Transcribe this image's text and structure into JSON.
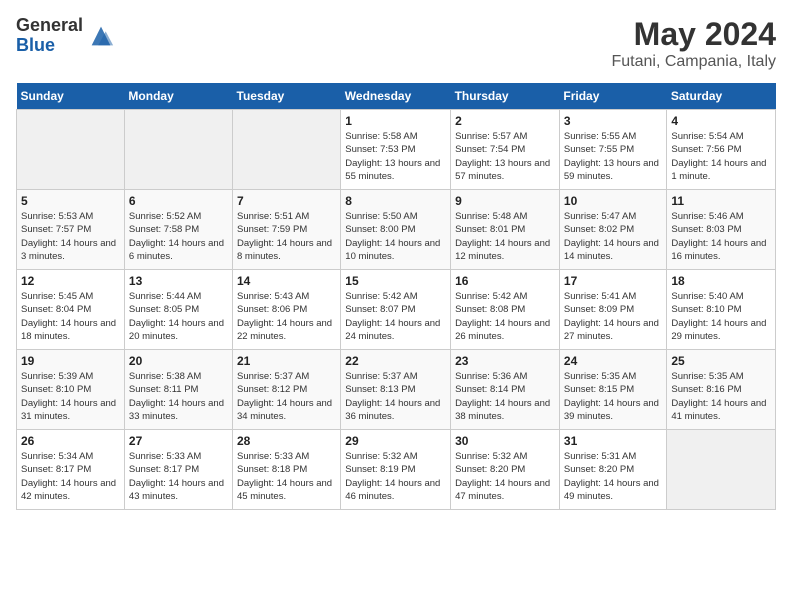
{
  "logo": {
    "general": "General",
    "blue": "Blue"
  },
  "title": "May 2024",
  "location": "Futani, Campania, Italy",
  "days_of_week": [
    "Sunday",
    "Monday",
    "Tuesday",
    "Wednesday",
    "Thursday",
    "Friday",
    "Saturday"
  ],
  "weeks": [
    [
      {
        "num": "",
        "detail": ""
      },
      {
        "num": "",
        "detail": ""
      },
      {
        "num": "",
        "detail": ""
      },
      {
        "num": "1",
        "detail": "Sunrise: 5:58 AM\nSunset: 7:53 PM\nDaylight: 13 hours and 55 minutes."
      },
      {
        "num": "2",
        "detail": "Sunrise: 5:57 AM\nSunset: 7:54 PM\nDaylight: 13 hours and 57 minutes."
      },
      {
        "num": "3",
        "detail": "Sunrise: 5:55 AM\nSunset: 7:55 PM\nDaylight: 13 hours and 59 minutes."
      },
      {
        "num": "4",
        "detail": "Sunrise: 5:54 AM\nSunset: 7:56 PM\nDaylight: 14 hours and 1 minute."
      }
    ],
    [
      {
        "num": "5",
        "detail": "Sunrise: 5:53 AM\nSunset: 7:57 PM\nDaylight: 14 hours and 3 minutes."
      },
      {
        "num": "6",
        "detail": "Sunrise: 5:52 AM\nSunset: 7:58 PM\nDaylight: 14 hours and 6 minutes."
      },
      {
        "num": "7",
        "detail": "Sunrise: 5:51 AM\nSunset: 7:59 PM\nDaylight: 14 hours and 8 minutes."
      },
      {
        "num": "8",
        "detail": "Sunrise: 5:50 AM\nSunset: 8:00 PM\nDaylight: 14 hours and 10 minutes."
      },
      {
        "num": "9",
        "detail": "Sunrise: 5:48 AM\nSunset: 8:01 PM\nDaylight: 14 hours and 12 minutes."
      },
      {
        "num": "10",
        "detail": "Sunrise: 5:47 AM\nSunset: 8:02 PM\nDaylight: 14 hours and 14 minutes."
      },
      {
        "num": "11",
        "detail": "Sunrise: 5:46 AM\nSunset: 8:03 PM\nDaylight: 14 hours and 16 minutes."
      }
    ],
    [
      {
        "num": "12",
        "detail": "Sunrise: 5:45 AM\nSunset: 8:04 PM\nDaylight: 14 hours and 18 minutes."
      },
      {
        "num": "13",
        "detail": "Sunrise: 5:44 AM\nSunset: 8:05 PM\nDaylight: 14 hours and 20 minutes."
      },
      {
        "num": "14",
        "detail": "Sunrise: 5:43 AM\nSunset: 8:06 PM\nDaylight: 14 hours and 22 minutes."
      },
      {
        "num": "15",
        "detail": "Sunrise: 5:42 AM\nSunset: 8:07 PM\nDaylight: 14 hours and 24 minutes."
      },
      {
        "num": "16",
        "detail": "Sunrise: 5:42 AM\nSunset: 8:08 PM\nDaylight: 14 hours and 26 minutes."
      },
      {
        "num": "17",
        "detail": "Sunrise: 5:41 AM\nSunset: 8:09 PM\nDaylight: 14 hours and 27 minutes."
      },
      {
        "num": "18",
        "detail": "Sunrise: 5:40 AM\nSunset: 8:10 PM\nDaylight: 14 hours and 29 minutes."
      }
    ],
    [
      {
        "num": "19",
        "detail": "Sunrise: 5:39 AM\nSunset: 8:10 PM\nDaylight: 14 hours and 31 minutes."
      },
      {
        "num": "20",
        "detail": "Sunrise: 5:38 AM\nSunset: 8:11 PM\nDaylight: 14 hours and 33 minutes."
      },
      {
        "num": "21",
        "detail": "Sunrise: 5:37 AM\nSunset: 8:12 PM\nDaylight: 14 hours and 34 minutes."
      },
      {
        "num": "22",
        "detail": "Sunrise: 5:37 AM\nSunset: 8:13 PM\nDaylight: 14 hours and 36 minutes."
      },
      {
        "num": "23",
        "detail": "Sunrise: 5:36 AM\nSunset: 8:14 PM\nDaylight: 14 hours and 38 minutes."
      },
      {
        "num": "24",
        "detail": "Sunrise: 5:35 AM\nSunset: 8:15 PM\nDaylight: 14 hours and 39 minutes."
      },
      {
        "num": "25",
        "detail": "Sunrise: 5:35 AM\nSunset: 8:16 PM\nDaylight: 14 hours and 41 minutes."
      }
    ],
    [
      {
        "num": "26",
        "detail": "Sunrise: 5:34 AM\nSunset: 8:17 PM\nDaylight: 14 hours and 42 minutes."
      },
      {
        "num": "27",
        "detail": "Sunrise: 5:33 AM\nSunset: 8:17 PM\nDaylight: 14 hours and 43 minutes."
      },
      {
        "num": "28",
        "detail": "Sunrise: 5:33 AM\nSunset: 8:18 PM\nDaylight: 14 hours and 45 minutes."
      },
      {
        "num": "29",
        "detail": "Sunrise: 5:32 AM\nSunset: 8:19 PM\nDaylight: 14 hours and 46 minutes."
      },
      {
        "num": "30",
        "detail": "Sunrise: 5:32 AM\nSunset: 8:20 PM\nDaylight: 14 hours and 47 minutes."
      },
      {
        "num": "31",
        "detail": "Sunrise: 5:31 AM\nSunset: 8:20 PM\nDaylight: 14 hours and 49 minutes."
      },
      {
        "num": "",
        "detail": ""
      }
    ]
  ]
}
